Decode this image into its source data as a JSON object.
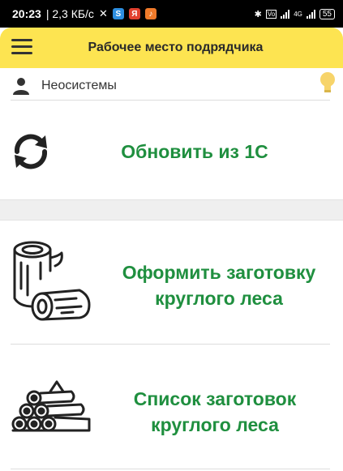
{
  "status_bar": {
    "time": "20:23",
    "speed": "| 2,3 КБ/с",
    "apps": [
      "S",
      "Я",
      "♪"
    ],
    "network": "4G",
    "battery": "55"
  },
  "app_bar": {
    "title": "Рабочее место подрядчика",
    "menu_icon": "hamburger-menu-icon"
  },
  "user": {
    "name": "Неосистемы",
    "icon": "person-icon",
    "hint_icon": "lightbulb-icon"
  },
  "actions": {
    "refresh": {
      "label": "Обновить из 1С",
      "icon": "refresh-icon"
    },
    "new_harvest": {
      "label_line1": "Оформить заготовку",
      "label_line2": "круглого леса",
      "icon": "logs-icon"
    },
    "harvest_list": {
      "label_line1": "Список заготовок",
      "label_line2": "круглого леса",
      "icon": "log-pile-icon"
    }
  },
  "colors": {
    "app_bar": "#fde451",
    "accent_green": "#1f8f3f",
    "bulb": "#f7d46a"
  }
}
